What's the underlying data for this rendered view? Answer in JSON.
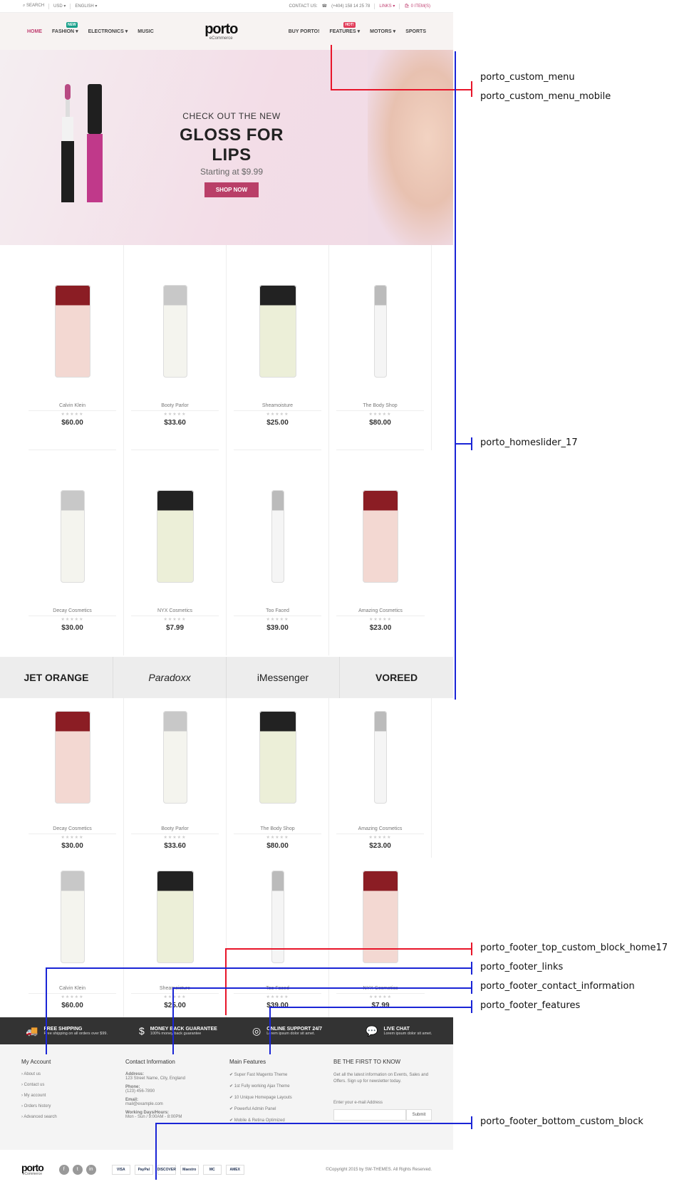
{
  "topbar": {
    "search": "SEARCH",
    "currency": "USD",
    "language": "ENGLISH",
    "contact_label": "CONTACT US:",
    "phone": "(+404) 158 14 25 78",
    "links": "LINKS",
    "cart": "0 ITEM(S)"
  },
  "header": {
    "brand": "porto",
    "brand_sub": "eCommerce",
    "nav_left": [
      "HOME",
      "FASHION",
      "ELECTRONICS",
      "MUSIC"
    ],
    "nav_right": [
      "BUY PORTO!",
      "FEATURES",
      "MOTORS",
      "SPORTS"
    ],
    "badge_new": "NEW",
    "badge_hot": "HOT!"
  },
  "slider": {
    "pre": "CHECK OUT THE NEW",
    "title": "GLOSS FOR LIPS",
    "price": "Starting at $9.99",
    "button": "SHOP NOW"
  },
  "products_row1": [
    {
      "brand": "Calvin Klein",
      "price": "$60.00"
    },
    {
      "brand": "Booty Parlor",
      "price": "$33.60"
    },
    {
      "brand": "Sheamoisture",
      "price": "$25.00"
    },
    {
      "brand": "The Body Shop",
      "price": "$80.00"
    }
  ],
  "products_row2": [
    {
      "brand": "Decay Cosmetics",
      "price": "$30.00"
    },
    {
      "brand": "NYX Cosmetics",
      "price": "$7.99"
    },
    {
      "brand": "Too Faced",
      "price": "$39.00"
    },
    {
      "brand": "Amazing Cosmetics",
      "price": "$23.00"
    }
  ],
  "brands": [
    "JET ORANGE",
    "Paradoxx",
    "iMessenger",
    "VOREED"
  ],
  "products_row3": [
    {
      "brand": "Decay Cosmetics",
      "price": "$30.00"
    },
    {
      "brand": "Booty Parlor",
      "price": "$33.60"
    },
    {
      "brand": "The Body Shop",
      "price": "$80.00"
    },
    {
      "brand": "Amazing Cosmetics",
      "price": "$23.00"
    }
  ],
  "products_row4": [
    {
      "brand": "Calvin Klein",
      "price": "$60.00"
    },
    {
      "brand": "Sheamoisture",
      "price": "$25.00"
    },
    {
      "brand": "Too Faced",
      "price": "$39.00"
    },
    {
      "brand": "NYX Cosmetics",
      "price": "$7.99"
    }
  ],
  "features": [
    {
      "title": "FREE SHIPPING",
      "desc": "Free shipping on all orders over $99."
    },
    {
      "title": "MONEY BACK GUARANTEE",
      "desc": "100% money back guarantee"
    },
    {
      "title": "ONLINE SUPPORT 24/7",
      "desc": "Lorem ipsum dolor sit amet."
    },
    {
      "title": "LIVE CHAT",
      "desc": "Lorem ipsum dolor sit amet."
    }
  ],
  "footer": {
    "account": {
      "title": "My Account",
      "links": [
        "About us",
        "Contact us",
        "My account",
        "Orders history",
        "Advanced search"
      ]
    },
    "contact": {
      "title": "Contact Information",
      "address_label": "Address:",
      "address": "123 Street Name, City, England",
      "phone_label": "Phone:",
      "phone": "(123) 456-7890",
      "email_label": "Email:",
      "email": "mail@example.com",
      "hours_label": "Working Days/Hours:",
      "hours": "Mon - Sun / 9:00AM - 8:00PM"
    },
    "main": {
      "title": "Main Features",
      "items": [
        "Super Fast Magento Theme",
        "1st Fully working Ajax Theme",
        "10 Unique Homepage Layouts",
        "Powerful Admin Panel",
        "Mobile & Retina Optimized"
      ]
    },
    "newsletter": {
      "title": "BE THE FIRST TO KNOW",
      "text": "Get all the latest information on Events, Sales and Offers. Sign up for newsletter today.",
      "label": "Enter your e-mail Address",
      "button": "Submit"
    }
  },
  "bottom": {
    "brand": "porto",
    "brand_sub": "eCommerce",
    "cards": [
      "VISA",
      "PayPal",
      "DISCOVER",
      "Maestro",
      "MC",
      "AMEX"
    ],
    "copyright": "©Copyright 2015 by SW-THEMES. All Rights Reserved."
  },
  "annotations": [
    "porto_custom_menu",
    "porto_custom_menu_mobile",
    "porto_homeslider_17",
    "porto_footer_top_custom_block_home17",
    "porto_footer_links",
    "porto_footer_contact_information",
    "porto_footer_features",
    "porto_footer_bottom_custom_block"
  ]
}
